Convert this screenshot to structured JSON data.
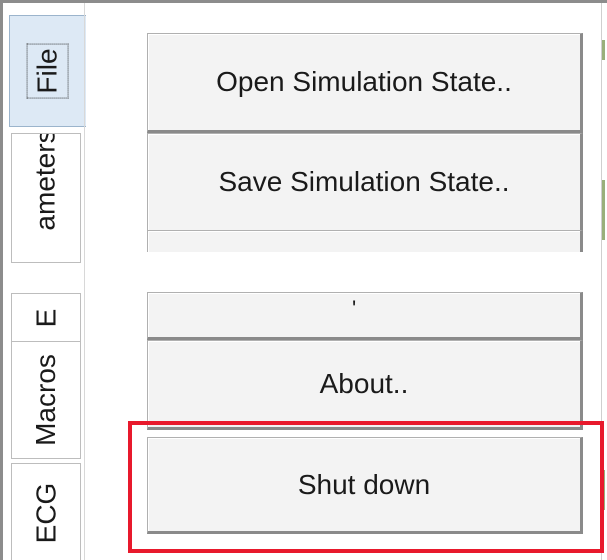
{
  "tabs": {
    "file": "File",
    "parameters": "ameters",
    "e": "E",
    "macros": "Macros",
    "ecg": "ECG"
  },
  "menu": {
    "open_label": "Open Simulation State..",
    "save_label": "Save Simulation State..",
    "hidden_glyph": "'",
    "about_label": "About..",
    "shutdown_label": "Shut down"
  },
  "colors": {
    "highlight": "#e8192c",
    "active_tab": "#dde9f5"
  }
}
